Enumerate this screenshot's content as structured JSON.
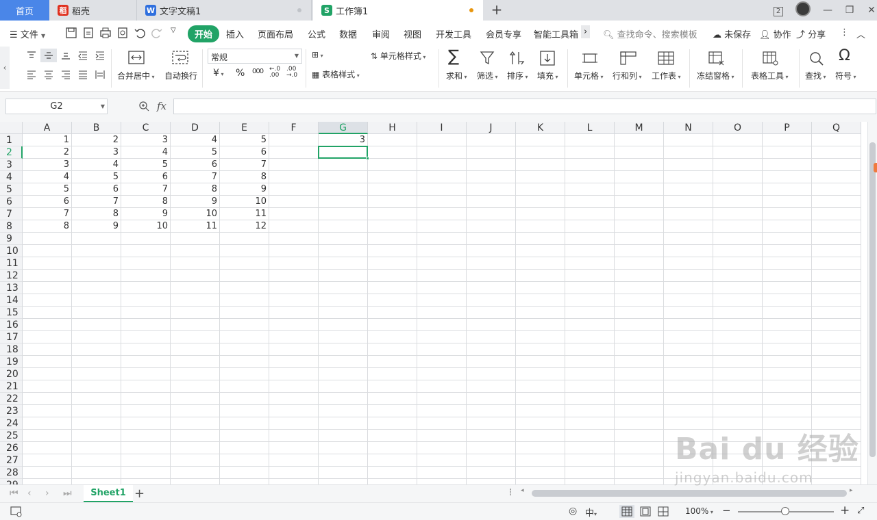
{
  "tabs": {
    "home": "首页",
    "daoke": "稻壳",
    "doc": "文字文稿1",
    "book": "工作簿1",
    "page_count_badge": "2"
  },
  "menu": {
    "file": "文件",
    "items": [
      "开始",
      "插入",
      "页面布局",
      "公式",
      "数据",
      "审阅",
      "视图",
      "开发工具",
      "会员专享",
      "智能工具箱"
    ],
    "active": "开始",
    "search_placeholder": "查找命令、搜索模板",
    "unsaved": "未保存",
    "collab": "协作",
    "share": "分享"
  },
  "ribbon": {
    "merge_center": "合并居中",
    "wrap": "自动换行",
    "number_format": "常规",
    "currency": "¥",
    "percent": "%",
    "thousands": "000",
    "cell_style": "单元格样式",
    "table_style": "表格样式",
    "sum": "求和",
    "filter": "筛选",
    "sort": "排序",
    "fill": "填充",
    "cell": "单元格",
    "rowcol": "行和列",
    "worksheet": "工作表",
    "freeze": "冻结窗格",
    "table_tools": "表格工具",
    "find": "查找",
    "symbol": "符号"
  },
  "formula_bar": {
    "name_box": "G2",
    "fx": "fx",
    "formula": ""
  },
  "sheet": {
    "columns": [
      "A",
      "B",
      "C",
      "D",
      "E",
      "F",
      "G",
      "H",
      "I",
      "J",
      "K",
      "L",
      "M",
      "N",
      "O",
      "P",
      "Q"
    ],
    "row_count": 29,
    "selected_col": "G",
    "selected_row": 2,
    "data": [
      [
        "1",
        "2",
        "3",
        "4",
        "5"
      ],
      [
        "2",
        "3",
        "4",
        "5",
        "6"
      ],
      [
        "3",
        "4",
        "5",
        "6",
        "7"
      ],
      [
        "4",
        "5",
        "6",
        "7",
        "8"
      ],
      [
        "5",
        "6",
        "7",
        "8",
        "9"
      ],
      [
        "6",
        "7",
        "8",
        "9",
        "10"
      ],
      [
        "7",
        "8",
        "9",
        "10",
        "11"
      ],
      [
        "8",
        "9",
        "10",
        "11",
        "12"
      ]
    ],
    "g1_value": "3"
  },
  "sheet_tabs": {
    "active": "Sheet1"
  },
  "status": {
    "zoom": "100%"
  },
  "watermark": {
    "brand": "Bai du 经验",
    "url": "jingyan.baidu.com"
  },
  "colors": {
    "accent": "#21a366",
    "home_tab": "#4a86e8",
    "modified_dot": "#e8960e"
  }
}
